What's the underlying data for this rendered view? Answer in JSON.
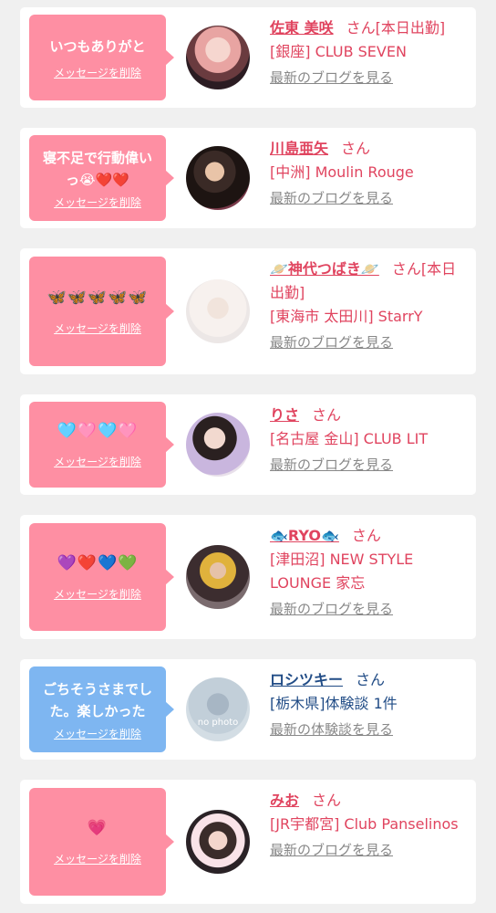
{
  "cards": [
    {
      "message": "いつもありがと",
      "delete_label": "メッセージを削除",
      "name": "佐東 美咲",
      "suffix": "さん[本日出勤]",
      "venue": "[銀座] CLUB SEVEN",
      "link": "最新のブログを見る",
      "bubble_color": "#fe8fa3"
    },
    {
      "message": "寝不足で行動偉いっ😭❤️❤️",
      "delete_label": "メッセージを削除",
      "name": "川島亜矢",
      "suffix": "さん",
      "venue": "[中洲] Moulin Rouge",
      "link": "最新のブログを見る",
      "bubble_color": "#fe8fa3"
    },
    {
      "message": "🦋🦋🦋🦋🦋",
      "delete_label": "メッセージを削除",
      "name": "🪐神代つばき🪐",
      "suffix": "さん[本日出勤]",
      "venue": "[東海市 太田川] StarrY",
      "link": "最新のブログを見る",
      "bubble_color": "#fe8fa3"
    },
    {
      "message": "🩵🩷🩵🩷",
      "delete_label": "メッセージを削除",
      "name": "りさ",
      "suffix": "さん",
      "venue": "[名古屋 金山] CLUB LIT",
      "link": "最新のブログを見る",
      "bubble_color": "#fe8fa3"
    },
    {
      "message": "💜❤️💙💚",
      "delete_label": "メッセージを削除",
      "name": "🐟RYO🐟",
      "suffix": "さん",
      "venue": "[津田沼] NEW STYLE LOUNGE 家忘",
      "link": "最新のブログを見る",
      "bubble_color": "#fe8fa3"
    },
    {
      "message": "ごちそうさまでした。楽しかった",
      "delete_label": "メッセージを削除",
      "name": "ロシツキー",
      "suffix": "さん",
      "venue": "[栃木県]体験談 1件",
      "link": "最新の体験談を見る",
      "avatar_text": "no photo",
      "bubble_color": "#7eb6f1"
    },
    {
      "message": "💗",
      "delete_label": "メッセージを削除",
      "name": "みお",
      "suffix": "さん",
      "venue": "[JR宇都宮] Club Panselinos",
      "link": "最新のブログを見る",
      "bubble_color": "#fe8fa3"
    }
  ]
}
